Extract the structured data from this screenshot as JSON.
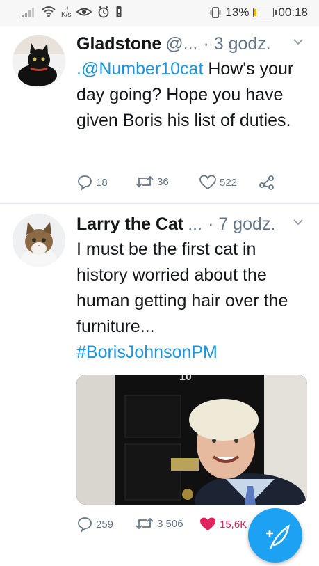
{
  "status_bar": {
    "speed_value": "0",
    "speed_unit": "K/s",
    "battery_percent": "13%",
    "time": "00:18",
    "battery_level": 0.13
  },
  "tweets": [
    {
      "name": "Gladstone",
      "handle": "@...",
      "time": "· 3 godz.",
      "mention": ".@Number10cat",
      "text": " How's your day going? Hope you have given Boris his list of duties.",
      "replies": "18",
      "retweets": "36",
      "likes": "522"
    },
    {
      "name": "Larry the Cat",
      "handle": "...",
      "time": "· 7 godz.",
      "text": "I must be the first cat in history worried about the human getting hair over the furniture...",
      "hashtag": "#BorisJohnsonPM",
      "replies": "259",
      "retweets": "3 506",
      "likes": "15,6K",
      "liked": true,
      "media_door_number": "10"
    }
  ],
  "icons": {
    "signal": "signal-icon",
    "wifi": "wifi-icon",
    "eye": "eye-icon",
    "alarm": "alarm-icon",
    "notification": "notification-icon",
    "vibrate": "vibrate-icon",
    "reply": "reply-icon",
    "retweet": "retweet-icon",
    "like": "heart-icon",
    "share": "share-icon",
    "chevron": "chevron-down-icon",
    "compose": "compose-icon"
  },
  "colors": {
    "link": "#1b95e0",
    "like_active": "#e0245e",
    "fab": "#1da1f2",
    "muted": "#657786"
  }
}
